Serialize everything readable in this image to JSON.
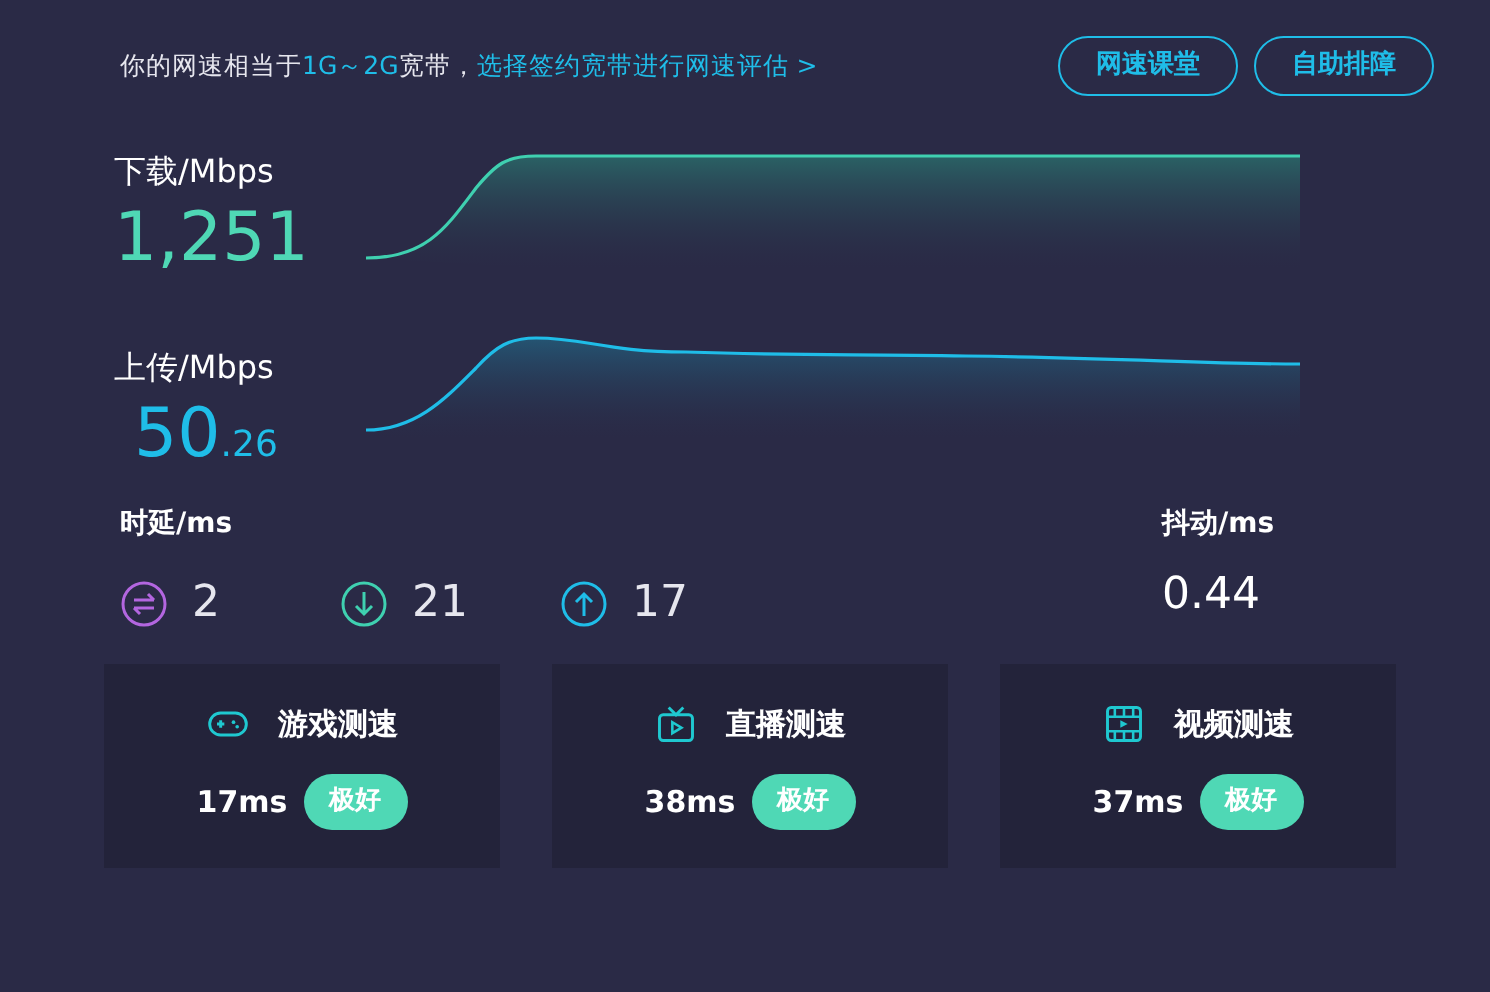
{
  "header": {
    "note_prefix": "你的网速相当于",
    "note_highlight": "1G～2G",
    "note_suffix": "宽带，",
    "link": "选择签约宽带进行网速评估 >",
    "buttons": [
      "网速课堂",
      "自助排障"
    ]
  },
  "download": {
    "label": "下载/Mbps",
    "value": "1,251"
  },
  "upload": {
    "label": "上传/Mbps",
    "value_main": "50",
    "value_fraction": ".26"
  },
  "latency": {
    "label": "时延/ms",
    "items": [
      {
        "kind": "idle",
        "value": "2"
      },
      {
        "kind": "down",
        "value": "21"
      },
      {
        "kind": "up",
        "value": "17"
      }
    ]
  },
  "jitter": {
    "label": "抖动/ms",
    "value": "0.44"
  },
  "cards": [
    {
      "kind": "game",
      "title": "游戏测速",
      "value": "17ms",
      "rating": "极好"
    },
    {
      "kind": "live",
      "title": "直播测速",
      "value": "38ms",
      "rating": "极好"
    },
    {
      "kind": "video",
      "title": "视频测速",
      "value": "37ms",
      "rating": "极好"
    }
  ]
}
